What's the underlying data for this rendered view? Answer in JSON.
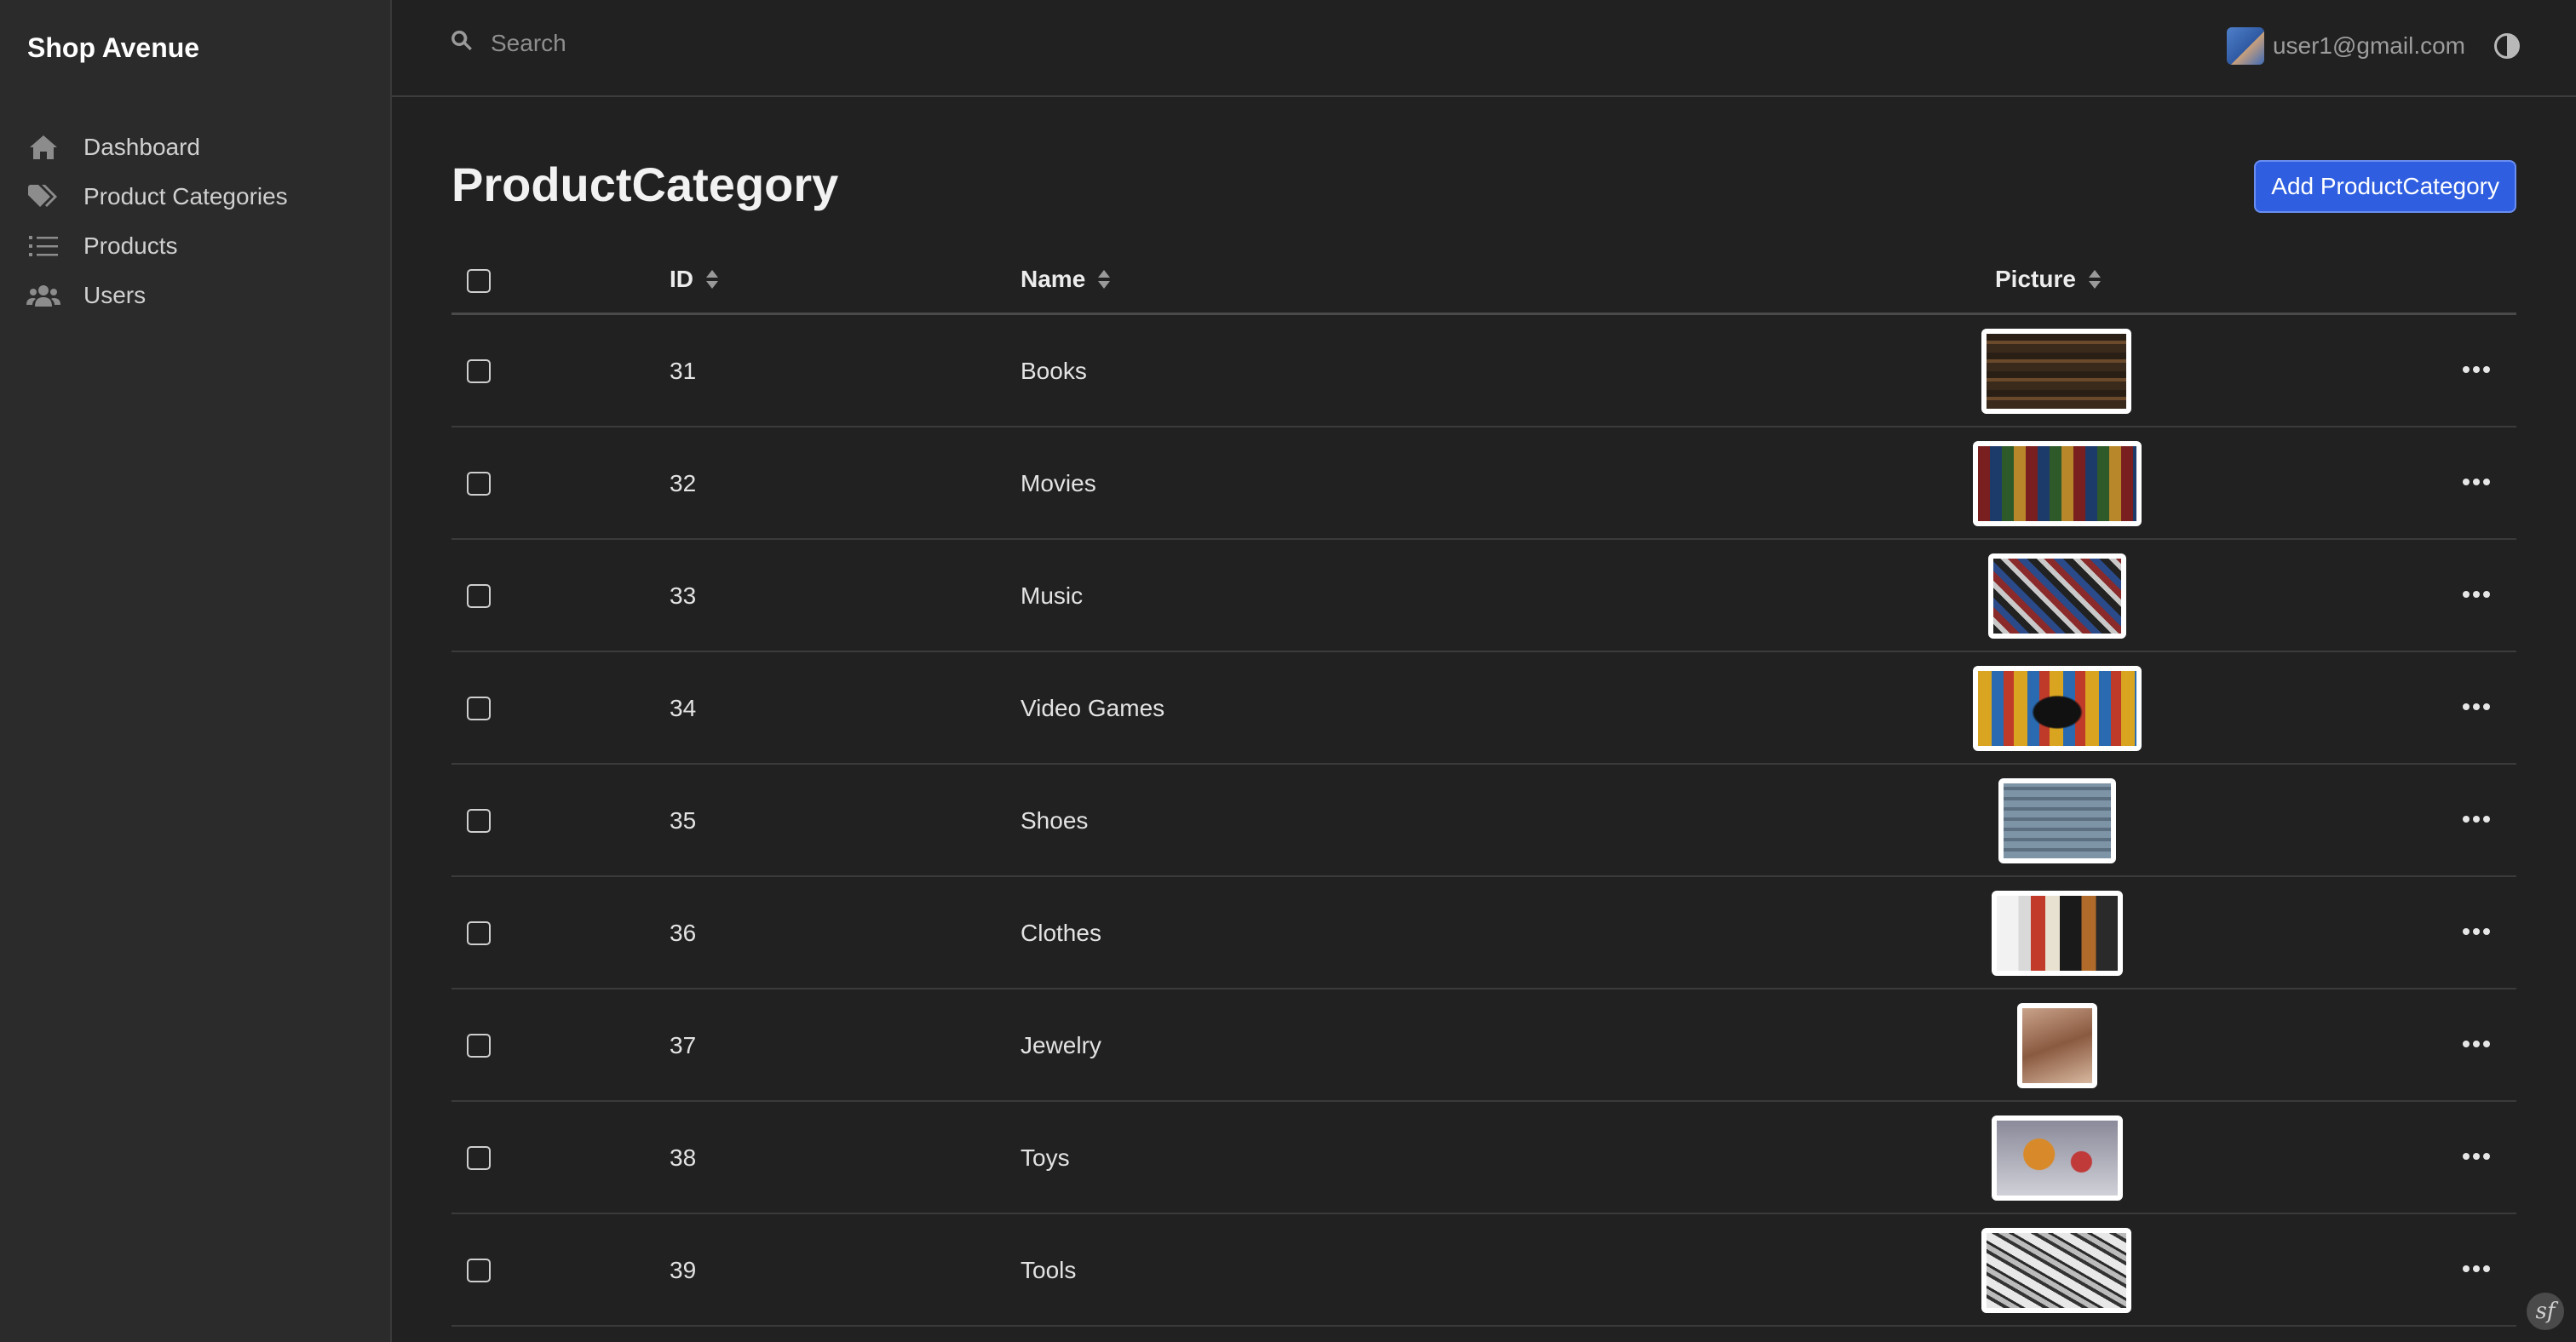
{
  "app": {
    "brand": "Shop Avenue"
  },
  "sidebar": {
    "items": [
      {
        "label": "Dashboard",
        "icon": "home-icon"
      },
      {
        "label": "Product Categories",
        "icon": "tags-icon"
      },
      {
        "label": "Products",
        "icon": "list-icon"
      },
      {
        "label": "Users",
        "icon": "users-icon"
      }
    ]
  },
  "header": {
    "search_placeholder": "Search",
    "user_email": "user1@gmail.com"
  },
  "page": {
    "title": "ProductCategory",
    "add_button_label": "Add ProductCategory"
  },
  "table": {
    "columns": {
      "id": "ID",
      "name": "Name",
      "picture": "Picture"
    },
    "rows": [
      {
        "id": "31",
        "name": "Books"
      },
      {
        "id": "32",
        "name": "Movies"
      },
      {
        "id": "33",
        "name": "Music"
      },
      {
        "id": "34",
        "name": "Video Games"
      },
      {
        "id": "35",
        "name": "Shoes"
      },
      {
        "id": "36",
        "name": "Clothes"
      },
      {
        "id": "37",
        "name": "Jewelry"
      },
      {
        "id": "38",
        "name": "Toys"
      },
      {
        "id": "39",
        "name": "Tools"
      }
    ]
  },
  "colors": {
    "accent": "#2f5fe0",
    "background": "#212121",
    "sidebar": "#2b2b2b"
  }
}
